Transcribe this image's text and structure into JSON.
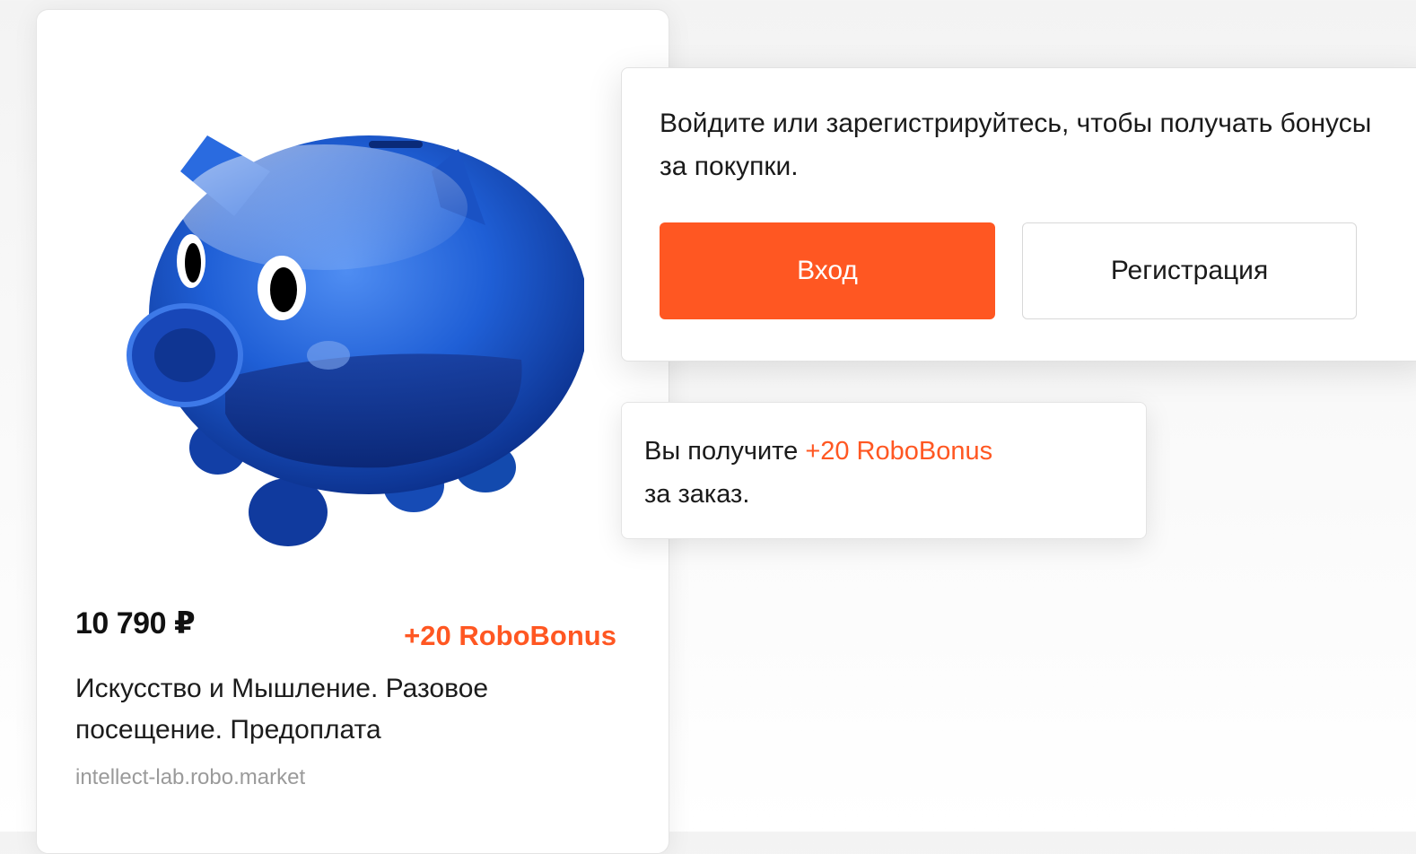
{
  "product": {
    "price": "10 790 ₽",
    "bonus": "+20 RoboBonus",
    "title": "Искусство и Мышление. Разовое посещение. Предоплата",
    "seller": "intellect-lab.robo.market",
    "image_icon": "piggy-bank"
  },
  "login_popup": {
    "message": "Войдите или зарегистрируйтесь, чтобы получать бонусы за покупки.",
    "login_label": "Вход",
    "register_label": "Регистрация"
  },
  "bonus_tooltip": {
    "prefix": "Вы получите ",
    "bonus": "+20 RoboBonus",
    "suffix": "за заказ."
  },
  "colors": {
    "accent": "#ff5722",
    "piggy_blue": "#1e5fd6"
  }
}
